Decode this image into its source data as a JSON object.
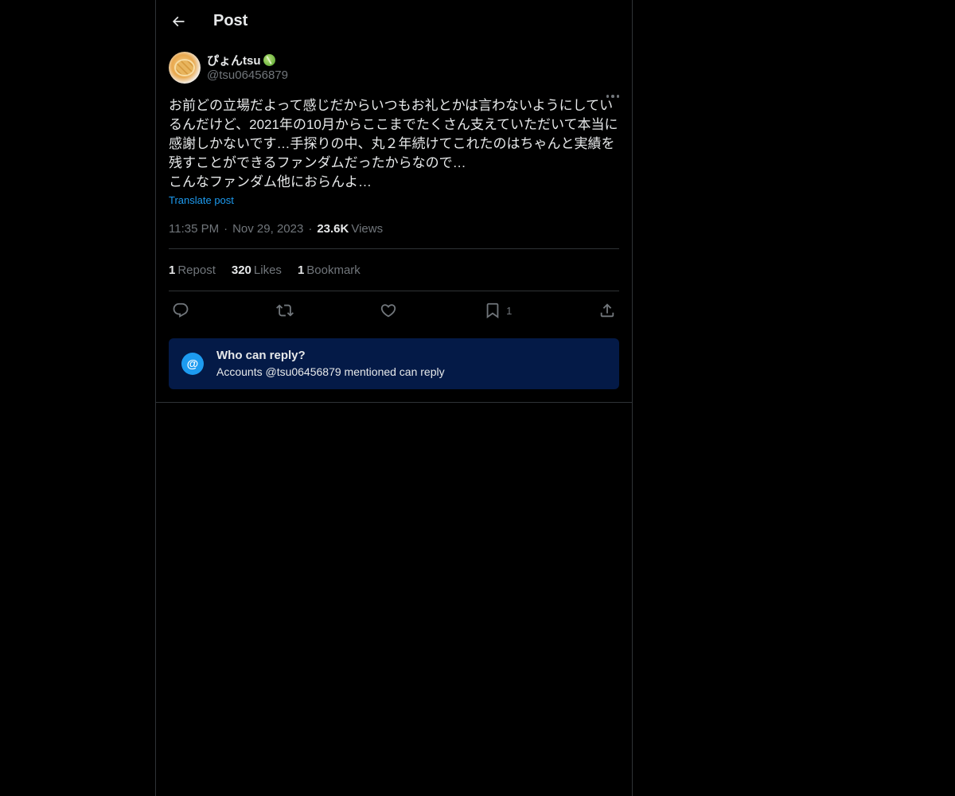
{
  "header": {
    "title": "Post",
    "back_icon": "arrow-left-icon"
  },
  "post": {
    "display_name": "ぴょんtsu",
    "handle": "@tsu06456879",
    "text": "お前どの立場だよって感じだからいつもお礼とかは言わないようにしているんだけど、2021年の10月からここまでたくさん支えていただいて本当に感謝しかないです…手探りの中、丸２年続けてこれたのはちゃんと実績を残すことができるファンダムだったからなので…\nこんなファンダム他におらんよ…",
    "translate_label": "Translate post",
    "time": "11:35 PM",
    "date": "Nov 29, 2023",
    "views_count": "23.6K",
    "views_label": "Views"
  },
  "stats": {
    "reposts_count": "1",
    "reposts_label": "Repost",
    "likes_count": "320",
    "likes_label": "Likes",
    "bookmarks_count": "1",
    "bookmarks_label": "Bookmark"
  },
  "actions": {
    "bookmark_count": "1",
    "icons": [
      "reply-icon",
      "repost-icon",
      "like-icon",
      "bookmark-icon",
      "share-icon"
    ]
  },
  "reply_restriction": {
    "icon_glyph": "@",
    "title": "Who can reply?",
    "subtitle": "Accounts @tsu06456879 mentioned can reply"
  },
  "colors": {
    "background": "#000000",
    "accent": "#1d9bf0",
    "muted": "#71767b",
    "reply_box": "#041a47"
  }
}
